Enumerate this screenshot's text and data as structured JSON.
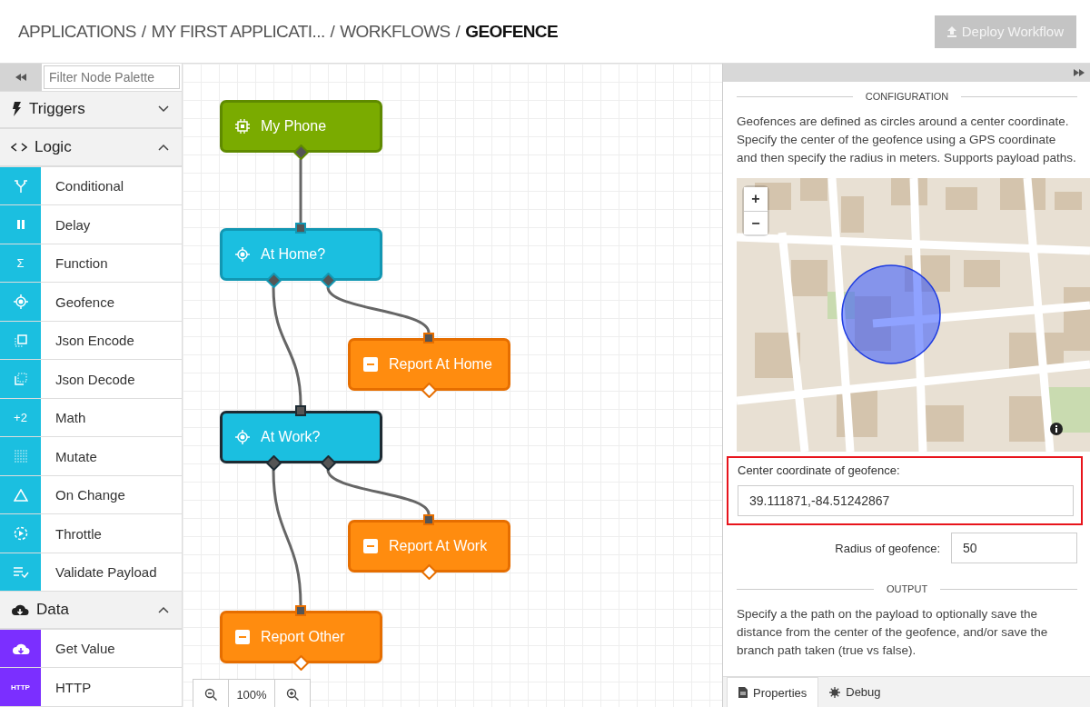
{
  "header": {
    "breadcrumb": [
      {
        "label": "APPLICATIONS",
        "separator": "/",
        "current": false
      },
      {
        "label": "MY FIRST APPLICATI...",
        "separator": "/",
        "current": false
      },
      {
        "label": "WORKFLOWS",
        "separator": "/",
        "current": false
      },
      {
        "label": "GEOFENCE",
        "current": true
      }
    ],
    "deploy_button": {
      "label": "Deploy Workflow",
      "disabled": true
    }
  },
  "palette": {
    "filter": {
      "placeholder": "Filter Node Palette"
    },
    "categories": [
      {
        "label": "Triggers",
        "expanded": false
      },
      {
        "label": "Logic",
        "expanded": true,
        "color": "#1bbfe0",
        "items": [
          {
            "label": "Conditional"
          },
          {
            "label": "Delay"
          },
          {
            "label": "Function",
            "icon_text": "Σ"
          },
          {
            "label": "Geofence"
          },
          {
            "label": "Json Encode"
          },
          {
            "label": "Json Decode"
          },
          {
            "label": "Math",
            "icon_text": "+2"
          },
          {
            "label": "Mutate"
          },
          {
            "label": "On Change"
          },
          {
            "label": "Throttle"
          },
          {
            "label": "Validate Payload"
          }
        ]
      },
      {
        "label": "Data",
        "expanded": true,
        "color": "#7b2fff",
        "items": [
          {
            "label": "Get Value"
          },
          {
            "label": "HTTP",
            "icon_text": "HTTP"
          }
        ]
      }
    ]
  },
  "canvas": {
    "nodes": [
      {
        "label": "My Phone",
        "kind": "device",
        "selected": false
      },
      {
        "label": "At Home?",
        "kind": "logic",
        "selected": false
      },
      {
        "label": "Report At Home",
        "kind": "output",
        "selected": false
      },
      {
        "label": "At Work?",
        "kind": "logic",
        "selected": true
      },
      {
        "label": "Report At Work",
        "kind": "output",
        "selected": false
      },
      {
        "label": "Report Other",
        "kind": "output",
        "selected": false
      }
    ],
    "zoom": {
      "level_text": "100%"
    }
  },
  "properties": {
    "config_heading": "CONFIGURATION",
    "config_text": "Geofences are defined as circles around a center coordinate. Specify the center of the geofence using a GPS coordinate and then specify the radius in meters. Supports payload paths.",
    "map": {
      "kind": "picture",
      "zoom_in": "+",
      "zoom_out": "−"
    },
    "center_field": {
      "label": "Center coordinate of geofence:",
      "value": "39.111871,-84.51242867",
      "highlighted": true
    },
    "radius_field": {
      "label": "Radius of geofence:",
      "value": "50"
    },
    "output_heading": "OUTPUT",
    "output_text": "Specify a the path on the payload to optionally save the distance from the center of the geofence, and/or save the branch path taken (true vs false).",
    "tabs": [
      {
        "label": "Properties",
        "selected": true
      },
      {
        "label": "Debug",
        "selected": false
      }
    ]
  }
}
